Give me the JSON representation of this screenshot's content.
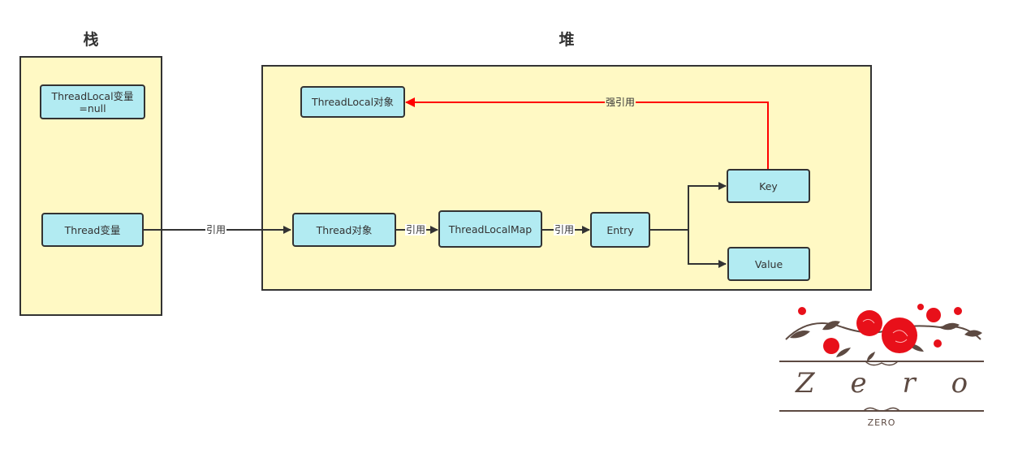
{
  "stack": {
    "title": "栈",
    "nodes": {
      "threadlocal_var": "ThreadLocal变量\n=null",
      "thread_var": "Thread变量"
    }
  },
  "heap": {
    "title": "堆",
    "nodes": {
      "threadlocal_obj": "ThreadLocal对象",
      "thread_obj": "Thread对象",
      "threadlocalmap": "ThreadLocalMap",
      "entry": "Entry",
      "key": "Key",
      "value": "Value"
    }
  },
  "edges": {
    "thread_ref": "引用",
    "map_ref": "引用",
    "entry_ref": "引用",
    "strong_ref": "强引用"
  },
  "colors": {
    "container_fill": "#fff9c4",
    "node_fill": "#b2ebf2",
    "border": "#333333",
    "strong_edge": "#ff0000"
  },
  "logo": {
    "script_text": "Zero",
    "caption": "ZERO"
  }
}
